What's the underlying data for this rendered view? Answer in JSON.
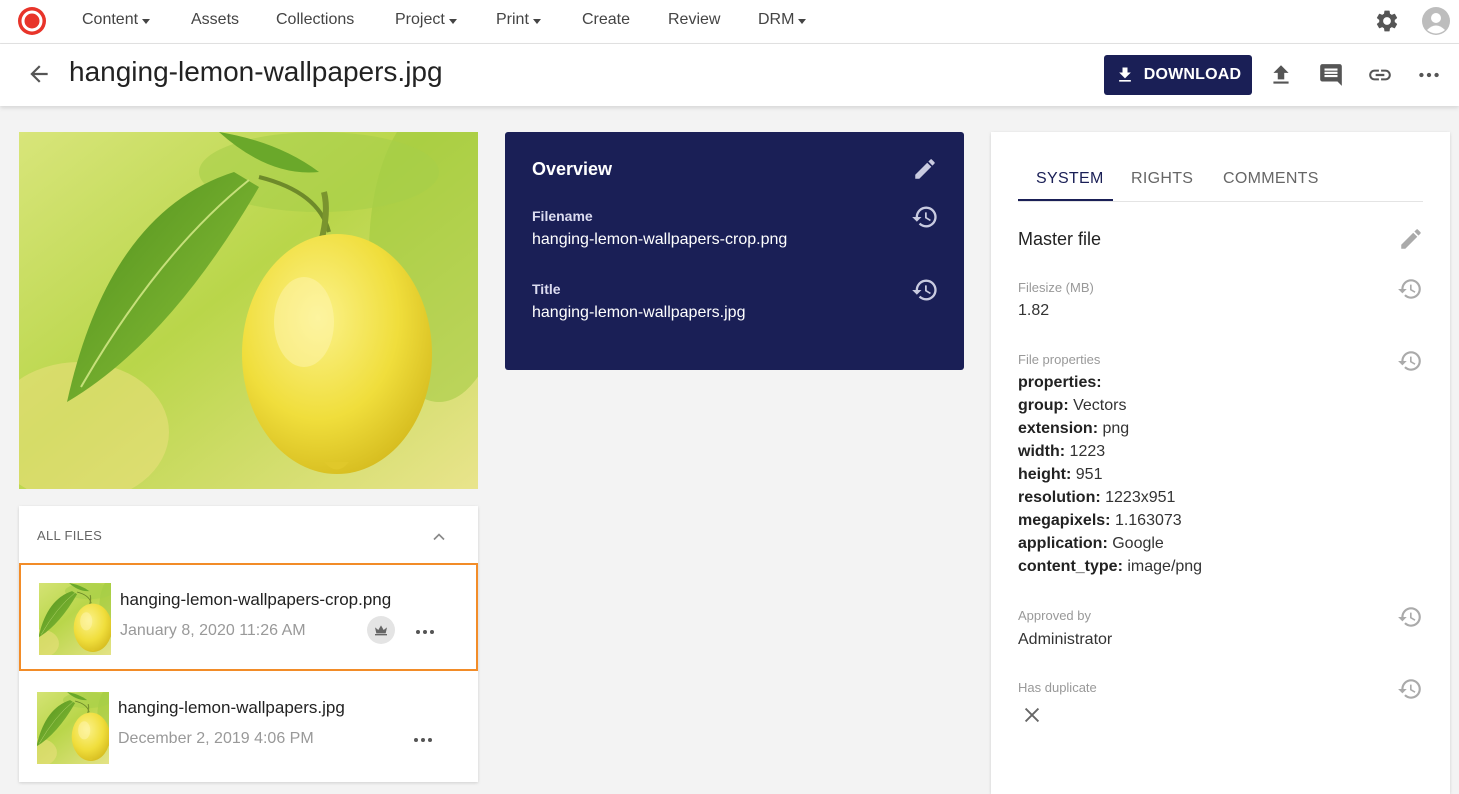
{
  "nav": {
    "items": [
      {
        "label": "Content",
        "has_caret": true
      },
      {
        "label": "Assets",
        "has_caret": false
      },
      {
        "label": "Collections",
        "has_caret": false
      },
      {
        "label": "Project",
        "has_caret": true
      },
      {
        "label": "Print",
        "has_caret": true
      },
      {
        "label": "Create",
        "has_caret": false
      },
      {
        "label": "Review",
        "has_caret": false
      },
      {
        "label": "DRM",
        "has_caret": true
      }
    ],
    "icons": [
      "logo-icon",
      "settings-gear-icon",
      "user-avatar-icon"
    ]
  },
  "header": {
    "title": "hanging-lemon-wallpapers.jpg",
    "download_label": "DOWNLOAD",
    "icons": [
      "back-arrow-icon",
      "download-icon",
      "upload-icon",
      "comment-icon",
      "link-icon",
      "more-options-icon"
    ]
  },
  "colors": {
    "brand_navy": "#1a1f56",
    "selected_outline": "#f28c28",
    "logo_red": "#e8342a"
  },
  "files": {
    "label": "ALL FILES",
    "items": [
      {
        "name": "hanging-lemon-wallpapers-crop.png",
        "date": "January 8, 2020 11:26 AM",
        "selected": true,
        "master": true
      },
      {
        "name": "hanging-lemon-wallpapers.jpg",
        "date": "December 2, 2019 4:06 PM",
        "selected": false,
        "master": false
      }
    ]
  },
  "overview": {
    "title": "Overview",
    "fields": [
      {
        "label": "Filename",
        "value": "hanging-lemon-wallpapers-crop.png"
      },
      {
        "label": "Title",
        "value": "hanging-lemon-wallpapers.jpg"
      }
    ]
  },
  "details": {
    "tabs": [
      {
        "label": "SYSTEM",
        "active": true
      },
      {
        "label": "RIGHTS",
        "active": false
      },
      {
        "label": "COMMENTS",
        "active": false
      }
    ],
    "section_title": "Master file",
    "filesize": {
      "label": "Filesize (MB)",
      "value": "1.82"
    },
    "file_properties": {
      "label": "File properties",
      "heading": "properties:",
      "entries": [
        {
          "key": "group:",
          "value": "Vectors"
        },
        {
          "key": "extension:",
          "value": "png"
        },
        {
          "key": "width:",
          "value": "1223"
        },
        {
          "key": "height:",
          "value": "951"
        },
        {
          "key": "resolution:",
          "value": "1223x951"
        },
        {
          "key": "megapixels:",
          "value": "1.163073"
        },
        {
          "key": "application:",
          "value": "Google"
        },
        {
          "key": "content_type:",
          "value": "image/png"
        }
      ]
    },
    "approved_by": {
      "label": "Approved by",
      "value": "Administrator"
    },
    "has_duplicate": {
      "label": "Has duplicate",
      "icon": "close-x-icon"
    }
  }
}
